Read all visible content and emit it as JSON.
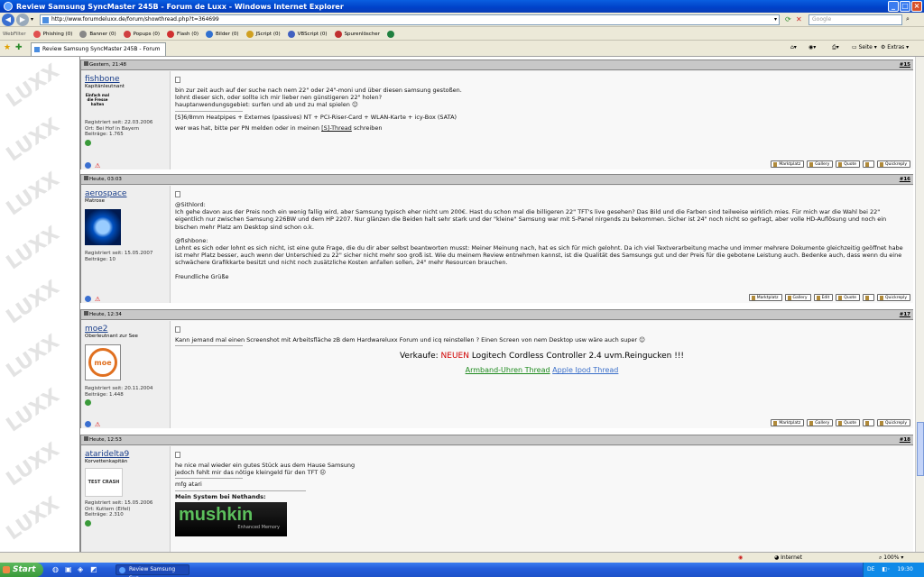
{
  "window": {
    "title": "Review Samsung SyncMaster 245B - Forum de Luxx - Windows Internet Explorer"
  },
  "address": {
    "url": "http://www.forumdeluxx.de/forum/showthread.php?t=364699",
    "search_placeholder": "Google"
  },
  "toolbar": {
    "webfilter": "WebFilter",
    "phishing": "Phishing (0)",
    "banner": "Banner (0)",
    "popups": "Popups (0)",
    "flash": "Flash (0)",
    "bilder": "Bilder (0)",
    "jscript": "JScript (0)",
    "vbscript": "VBScript (0)",
    "spuren": "Spurenlöscher"
  },
  "tab": {
    "label": "Review Samsung SyncMaster 245B - Forum de Luxx",
    "seite": "Seite",
    "extras": "Extras"
  },
  "watermark": "LUXX",
  "posts": [
    {
      "date": "Gestern, 21:48",
      "number": "#15",
      "user": "fishbone",
      "rank": "Kapitänleutnant",
      "avatar_text": "Einfach mal die Fresse halten",
      "registered": "Registriert seit: 22.03.2006",
      "location": "Ort: Bei Hof in Bayern",
      "count": "Beiträge: 1.765",
      "lines": [
        "bin zur zeit auch auf der suche nach nem 22\" oder 24\"-moni und über diesen samsung gestoßen.",
        "lohnt dieser sich, oder sollte ich mir lieber nen günstigeren 22\" holen?",
        "hauptanwendungsgebiet: surfen und ab und zu mal spielen ☺"
      ],
      "sig1": "[S]6/8mm Heatpipes + Externes (passives) NT + PCI-Riser-Card + WLAN-Karte + icy-Box (SATA)",
      "sig2_pre": "wer was hat, bitte per PN melden oder in meinen ",
      "sig2_link": "[S]-Thread",
      "sig2_post": " schreiben",
      "buttons": [
        "Marktplatz",
        "Gallery",
        "Quote",
        "",
        "Quickreply"
      ]
    },
    {
      "date": "Heute, 03:03",
      "number": "#16",
      "user": "aerospace",
      "rank": "Matrose",
      "registered": "Registriert seit: 15.05.2007",
      "count": "Beiträge: 10",
      "lines": [
        "@Sithlord:",
        "Ich gehe davon aus der Preis noch ein wenig fallig wird, aber Samsung typisch eher nicht um 200€. Hast du schon mal die billigeren 22\" TFT's live gesehen? Das Bild und die Farben sind teilweise wirklich mies. Für mich war die Wahl bei 22\" eigentlich nur zwischen Samsung 226BW und dem HP 2207. Nur glänzen die Beiden halt sehr stark und der \"kleine\" Samsung war mit S-Panel nirgends zu bekommen. Sicher ist 24\" noch nicht so gefragt, aber volle HD-Auflösung und noch ein bischen mehr Platz am Desktop sind schon o.k.",
        "",
        "@fishbone:",
        "Lohnt es sich oder lohnt es sich nicht, ist eine gute Frage, die du dir aber selbst beantworten musst: Meiner Meinung nach, hat es sich für mich gelohnt. Da ich viel Textverarbeitung mache und immer mehrere Dokumente gleichzeitig geöffnet habe ist mehr Platz besser, auch wenn der Unterschied zu 22\" sicher nicht mehr soo groß ist. Wie du meinem Review entnehmen kannst, ist die Qualität des Samsungs gut und der Preis für die gebotene Leistung auch. Bedenke auch, dass wenn du eine schwächere Grafikkarte besitzt und nicht noch zusätzliche Kosten anfallen sollen, 24\" mehr Resourcen brauchen.",
        "",
        "Freundliche Grüße"
      ],
      "buttons": [
        "Marktplatz",
        "Gallery",
        "Edit",
        "Quote",
        "",
        "Quickreply"
      ]
    },
    {
      "date": "Heute, 12:34",
      "number": "#17",
      "user": "moe2",
      "rank": "Oberleutnant zur See",
      "avatar_text": "moe",
      "registered": "Registriert seit: 20.11.2004",
      "count": "Beiträge: 1.448",
      "lines": [
        "Kann jemand mal einen Screenshot mit Arbeitsfläche zB dem Hardwareluxx Forum und icq reinstellen ? Einen Screen von nem Desktop usw wäre auch super ☺"
      ],
      "sig_verkauf": "Verkaufe: ",
      "sig_neuen": "NEUEN",
      "sig_rest": " Logitech Cordless Controller 2.4 uvm.Reingucken !!!",
      "sig_link1": "Armband-Uhren Thread",
      "sig_link2": "Apple Ipod Thread",
      "buttons": [
        "Marktplatz",
        "Gallery",
        "Quote",
        "",
        "Quickreply"
      ]
    },
    {
      "date": "Heute, 12:53",
      "number": "#18",
      "user": "ataridelta9",
      "rank": "Korvettenkapitän",
      "avatar_text": "TEST CRASH",
      "registered": "Registriert seit: 15.05.2006",
      "location": "Ort: Kuttern (Eifel)",
      "count": "Beiträge: 2.310",
      "lines": [
        "he nice mal wieder ein gutes Stück aus dem Hause Samsung",
        "jedoch fehlt mir das nötige kleingeld für den TFT ☹"
      ],
      "sig1": "mfg atari",
      "sig_system": "Mein System bei Nethands:",
      "sig_logo": "mushkin",
      "sig_logo_sub": "Enhanced Memory"
    }
  ],
  "status": {
    "zone": "Internet",
    "zoom": "100%"
  },
  "taskbar": {
    "start": "Start",
    "item": "Review Samsung Syn...",
    "lang": "DE",
    "time": "19:30"
  }
}
